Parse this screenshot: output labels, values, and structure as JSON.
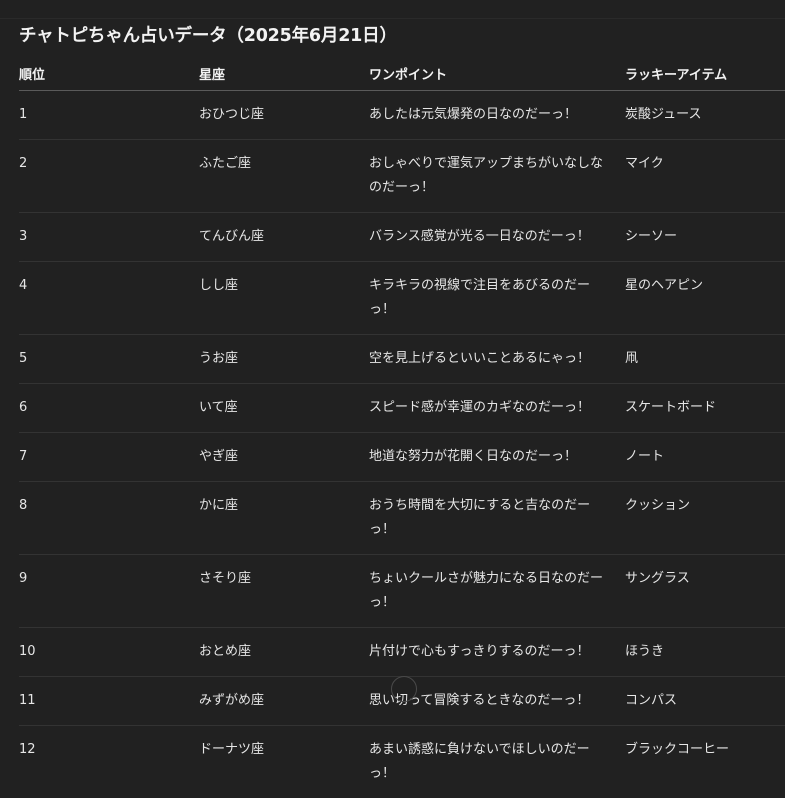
{
  "title": "チャトピちゃん占いデータ（2025年6月21日）",
  "table": {
    "headers": [
      "順位",
      "星座",
      "ワンポイント",
      "ラッキーアイテム"
    ],
    "rows": [
      {
        "rank": "1",
        "sign": "おひつじ座",
        "point": "あしたは元気爆発の日なのだーっ！",
        "item": "炭酸ジュース"
      },
      {
        "rank": "2",
        "sign": "ふたご座",
        "point": "おしゃべりで運気アップまちがいなしなのだーっ！",
        "item": "マイク"
      },
      {
        "rank": "3",
        "sign": "てんびん座",
        "point": "バランス感覚が光る一日なのだーっ！",
        "item": "シーソー"
      },
      {
        "rank": "4",
        "sign": "しし座",
        "point": "キラキラの視線で注目をあびるのだーっ！",
        "item": "星のヘアピン"
      },
      {
        "rank": "5",
        "sign": "うお座",
        "point": "空を見上げるといいことあるにゃっ！",
        "item": "凧"
      },
      {
        "rank": "6",
        "sign": "いて座",
        "point": "スピード感が幸運のカギなのだーっ！",
        "item": "スケートボード"
      },
      {
        "rank": "7",
        "sign": "やぎ座",
        "point": "地道な努力が花開く日なのだーっ！",
        "item": "ノート"
      },
      {
        "rank": "8",
        "sign": "かに座",
        "point": "おうち時間を大切にすると吉なのだーっ！",
        "item": "クッション"
      },
      {
        "rank": "9",
        "sign": "さそり座",
        "point": "ちょいクールさが魅力になる日なのだーっ！",
        "item": "サングラス"
      },
      {
        "rank": "10",
        "sign": "おとめ座",
        "point": "片付けで心もすっきりするのだーっ！",
        "item": "ほうき"
      },
      {
        "rank": "11",
        "sign": "みずがめ座",
        "point": "思い切って冒険するときなのだーっ！",
        "item": "コンパス"
      },
      {
        "rank": "12",
        "sign": "ドーナツ座",
        "point": "あまい誘惑に負けないでほしいのだーっ！",
        "item": "ブラックコーヒー"
      }
    ]
  }
}
